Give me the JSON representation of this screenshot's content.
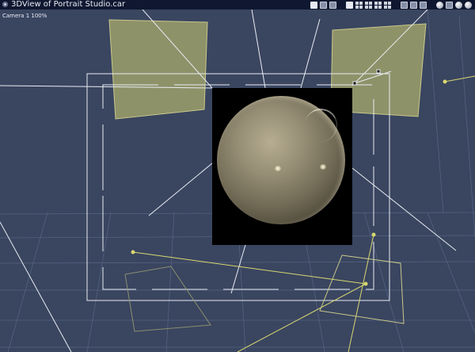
{
  "window": {
    "title": "3DView of Portrait Studio.car"
  },
  "viewport": {
    "camera_label": "Camera 1 100%",
    "background_color": "#3a4560",
    "grid_color": "#5a6a88",
    "frame_color": "#e8ecf2",
    "light_color": "#d8d870",
    "reflector_color": "#a7a86c"
  },
  "toolbar": {
    "icons": [
      "menu-icon",
      "move-icon",
      "rotate-icon",
      "zoom-icon",
      "view-single-icon",
      "view-split-icon",
      "view-quad-icon",
      "view-grid-icon",
      "view-layout-icon",
      "camera-icon",
      "camera-target-icon",
      "light-icon",
      "globe-icon",
      "cube-icon",
      "shading-icon",
      "sphere-preview-icon"
    ]
  },
  "render_preview": {
    "description_shown": "",
    "background_color": "#000000"
  }
}
